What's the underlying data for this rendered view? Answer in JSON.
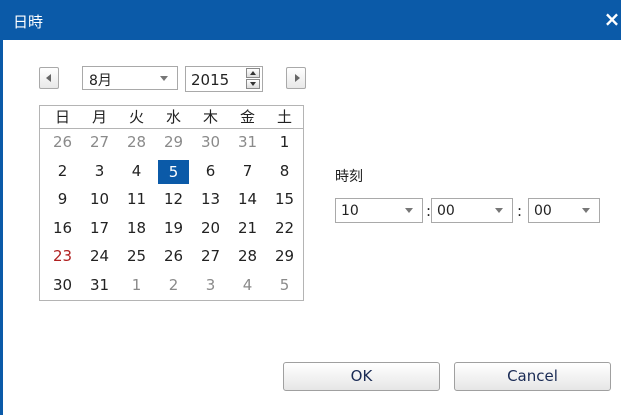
{
  "window": {
    "title": "日時",
    "close_glyph": "×"
  },
  "calendar": {
    "month": "8月",
    "year": "2015",
    "weekdays": [
      "日",
      "月",
      "火",
      "水",
      "木",
      "金",
      "土"
    ],
    "weeks": [
      [
        {
          "d": "26",
          "other": true
        },
        {
          "d": "27",
          "other": true
        },
        {
          "d": "28",
          "other": true
        },
        {
          "d": "29",
          "other": true
        },
        {
          "d": "30",
          "other": true
        },
        {
          "d": "31",
          "other": true
        },
        {
          "d": "1"
        }
      ],
      [
        {
          "d": "2"
        },
        {
          "d": "3"
        },
        {
          "d": "4"
        },
        {
          "d": "5",
          "selected": true
        },
        {
          "d": "6"
        },
        {
          "d": "7"
        },
        {
          "d": "8"
        }
      ],
      [
        {
          "d": "9"
        },
        {
          "d": "10"
        },
        {
          "d": "11"
        },
        {
          "d": "12"
        },
        {
          "d": "13"
        },
        {
          "d": "14"
        },
        {
          "d": "15"
        }
      ],
      [
        {
          "d": "16"
        },
        {
          "d": "17"
        },
        {
          "d": "18"
        },
        {
          "d": "19"
        },
        {
          "d": "20"
        },
        {
          "d": "21"
        },
        {
          "d": "22"
        }
      ],
      [
        {
          "d": "23",
          "sunday": true
        },
        {
          "d": "24"
        },
        {
          "d": "25"
        },
        {
          "d": "26"
        },
        {
          "d": "27"
        },
        {
          "d": "28"
        },
        {
          "d": "29"
        }
      ],
      [
        {
          "d": "30"
        },
        {
          "d": "31"
        },
        {
          "d": "1",
          "other": true
        },
        {
          "d": "2",
          "other": true
        },
        {
          "d": "3",
          "other": true
        },
        {
          "d": "4",
          "other": true
        },
        {
          "d": "5",
          "other": true
        }
      ]
    ]
  },
  "time": {
    "label": "時刻",
    "hour": "10",
    "minute": "00",
    "second": "00",
    "separator": ":"
  },
  "buttons": {
    "ok": "OK",
    "cancel": "Cancel"
  },
  "colors": {
    "accent": "#0b5aa8",
    "sunday": "#b02020"
  },
  "icons": {
    "prev": "chevron-left-icon",
    "next": "chevron-right-icon",
    "dropdown": "chevron-down-icon",
    "spin_up": "spin-up-icon",
    "spin_down": "spin-down-icon",
    "close": "close-icon"
  }
}
